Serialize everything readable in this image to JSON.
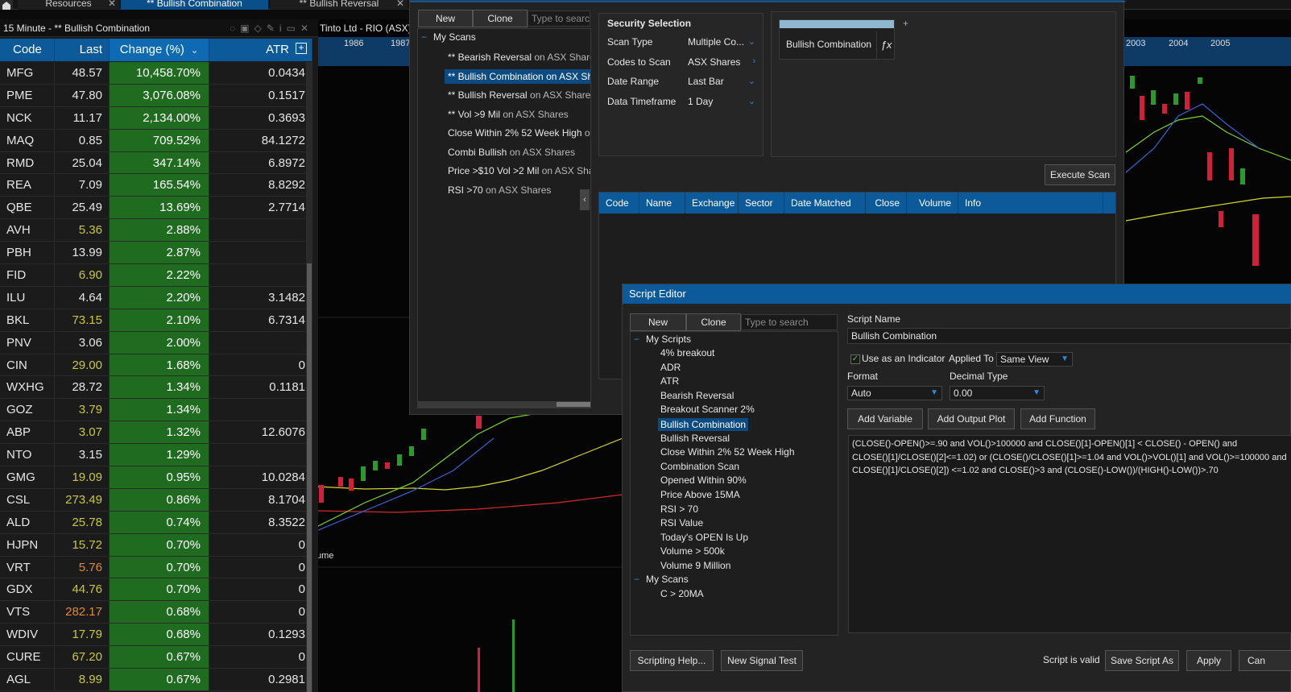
{
  "tabs": [
    {
      "label": "Resources"
    },
    {
      "label": "** Bullish Combination"
    },
    {
      "label": "** Bullish Reversal"
    }
  ],
  "watchlist": {
    "title": "15 Minute - ** Bullish Combination",
    "columns": {
      "code": "Code",
      "last": "Last",
      "change": "Change (%)",
      "atr": "ATR"
    },
    "rows": [
      {
        "code": "MFG",
        "last": "48.57",
        "change": "10,458.70%",
        "atr": "0.0434",
        "color": "#e6e6e6"
      },
      {
        "code": "PME",
        "last": "47.80",
        "change": "3,076.08%",
        "atr": "0.1517",
        "color": "#e6e6e6"
      },
      {
        "code": "NCK",
        "last": "11.17",
        "change": "2,134.00%",
        "atr": "0.3693",
        "color": "#e6e6e6"
      },
      {
        "code": "MAQ",
        "last": "0.85",
        "change": "709.52%",
        "atr": "84.1272",
        "color": "#e6e6e6"
      },
      {
        "code": "RMD",
        "last": "25.04",
        "change": "347.14%",
        "atr": "6.8972",
        "color": "#e6e6e6"
      },
      {
        "code": "REA",
        "last": "7.09",
        "change": "165.54%",
        "atr": "8.8292",
        "color": "#e6e6e6"
      },
      {
        "code": "QBE",
        "last": "25.49",
        "change": "13.69%",
        "atr": "2.7714",
        "color": "#e6e6e6"
      },
      {
        "code": "AVH",
        "last": "5.36",
        "change": "2.88%",
        "atr": "",
        "color": "#c8c83a"
      },
      {
        "code": "PBH",
        "last": "13.99",
        "change": "2.87%",
        "atr": "",
        "color": "#e6e6e6"
      },
      {
        "code": "FID",
        "last": "6.90",
        "change": "2.22%",
        "atr": "",
        "color": "#c8c83a"
      },
      {
        "code": "ILU",
        "last": "4.64",
        "change": "2.20%",
        "atr": "3.1482",
        "color": "#e6e6e6"
      },
      {
        "code": "BKL",
        "last": "73.15",
        "change": "2.10%",
        "atr": "6.7314",
        "color": "#c8c83a"
      },
      {
        "code": "PNV",
        "last": "3.06",
        "change": "2.00%",
        "atr": "",
        "color": "#e6e6e6"
      },
      {
        "code": "CIN",
        "last": "29.00",
        "change": "1.68%",
        "atr": "0",
        "color": "#c8c83a"
      },
      {
        "code": "WXHG",
        "last": "28.72",
        "change": "1.34%",
        "atr": "0.1181",
        "color": "#e6e6e6"
      },
      {
        "code": "GOZ",
        "last": "3.79",
        "change": "1.34%",
        "atr": "",
        "color": "#c8c83a"
      },
      {
        "code": "ABP",
        "last": "3.07",
        "change": "1.32%",
        "atr": "12.6076",
        "color": "#c8c83a"
      },
      {
        "code": "NTO",
        "last": "3.15",
        "change": "1.29%",
        "atr": "",
        "color": "#e6e6e6"
      },
      {
        "code": "GMG",
        "last": "19.09",
        "change": "0.95%",
        "atr": "10.0284",
        "color": "#c8c83a"
      },
      {
        "code": "CSL",
        "last": "273.49",
        "change": "0.86%",
        "atr": "8.1704",
        "color": "#c8c83a"
      },
      {
        "code": "ALD",
        "last": "25.78",
        "change": "0.74%",
        "atr": "8.3522",
        "color": "#c8c83a"
      },
      {
        "code": "HJPN",
        "last": "15.72",
        "change": "0.70%",
        "atr": "0",
        "color": "#c8c83a"
      },
      {
        "code": "VRT",
        "last": "5.76",
        "change": "0.70%",
        "atr": "0",
        "color": "#e08a2a"
      },
      {
        "code": "GDX",
        "last": "44.76",
        "change": "0.70%",
        "atr": "0",
        "color": "#c8c83a"
      },
      {
        "code": "VTS",
        "last": "282.17",
        "change": "0.68%",
        "atr": "0",
        "color": "#e08a2a"
      },
      {
        "code": "WDIV",
        "last": "17.79",
        "change": "0.68%",
        "atr": "0.1293",
        "color": "#c8c83a"
      },
      {
        "code": "CURE",
        "last": "67.20",
        "change": "0.67%",
        "atr": "0",
        "color": "#c8c83a"
      },
      {
        "code": "AGL",
        "last": "8.99",
        "change": "0.67%",
        "atr": "0.2981",
        "color": "#c8c83a"
      }
    ]
  },
  "chart": {
    "title": "Tinto Ltd - RIO (ASX) -",
    "years_left": [
      "1986",
      "1987"
    ],
    "years_right": [
      "2003",
      "2004",
      "2005"
    ],
    "volume_label": "ume"
  },
  "scanner": {
    "new_label": "New",
    "clone_label": "Clone",
    "search_placeholder": "Type to search",
    "tree_root": "My Scans",
    "scans": [
      {
        "name": "** Bearish Reversal",
        "suffix": " on ASX Shares"
      },
      {
        "name": "** Bullish Combination",
        "suffix": " on ASX Sha"
      },
      {
        "name": "** Bullish Reversal",
        "suffix": " on ASX Shares"
      },
      {
        "name": "** Vol >9 Mil",
        "suffix": " on ASX Shares"
      },
      {
        "name": "Close Within 2% 52 Week High",
        "suffix": " on A"
      },
      {
        "name": "Combi Bullish",
        "suffix": " on ASX Shares"
      },
      {
        "name": "Price >$10 Vol >2 Mil",
        "suffix": " on ASX Shares"
      },
      {
        "name": "RSI >70",
        "suffix": " on ASX Shares"
      }
    ],
    "security_selection": {
      "title": "Security Selection",
      "fields": [
        {
          "label": "Scan Type",
          "value": "Multiple Co..."
        },
        {
          "label": "Codes to Scan",
          "value": "ASX Shares"
        },
        {
          "label": "Date Range",
          "value": "Last Bar"
        },
        {
          "label": "Data Timeframe",
          "value": "1 Day"
        }
      ]
    },
    "criteria_item": "Bullish Combination",
    "fx_label": "ƒx",
    "plus_label": "+",
    "execute_label": "Execute Scan",
    "results_columns": [
      "Code",
      "Name",
      "Exchange",
      "Sector",
      "Date Matched",
      "Close",
      "Volume",
      "Info"
    ]
  },
  "script_editor": {
    "title": "Script Editor",
    "new_label": "New",
    "clone_label": "Clone",
    "search_placeholder": "Type to search",
    "scripts_root": "My Scripts",
    "scripts": [
      "4% breakout",
      "ADR",
      "ATR",
      "Bearish Reversal",
      "Breakout Scanner 2%",
      "Bullish Combination",
      "Bullish Reversal",
      "Close Within 2% 52 Week High",
      "Combination Scan",
      "Opened Within 90%",
      "Price Above 15MA",
      "RSI > 70",
      "RSI Value",
      "Today's OPEN Is Up",
      "Volume > 500k",
      "Volume 9 Million"
    ],
    "scans_root": "My Scans",
    "scans": [
      "C > 20MA"
    ],
    "script_name_label": "Script Name",
    "script_name_value": "Bullish Combination",
    "use_indicator_label": "Use as an Indicator",
    "applied_to_label": "Applied To",
    "applied_to_value": "Same View",
    "format_label": "Format",
    "format_value": "Auto",
    "decimal_label": "Decimal Type",
    "decimal_value": "0.00",
    "add_variable_label": "Add Variable",
    "add_output_label": "Add Output Plot",
    "add_function_label": "Add Function",
    "code": "(CLOSE()-OPEN()>=.90 and VOL()>100000 and CLOSE()[1]-OPEN()[1] < CLOSE() - OPEN() and\nCLOSE()[1]/CLOSE()[2]<=1.02) or (CLOSE()/CLOSE()[1]>=1.04 and VOL()>VOL()[1] and VOL()>=100000 and\nCLOSE()[1]/CLOSE()[2]) <=1.02 and CLOSE()>3 and (CLOSE()-LOW())/(HIGH()-LOW())>.70",
    "help_label": "Scripting Help...",
    "signal_label": "New Signal Test",
    "valid_label": "Script is valid",
    "save_as_label": "Save Script As",
    "apply_label": "Apply",
    "cancel_label": "Can"
  }
}
